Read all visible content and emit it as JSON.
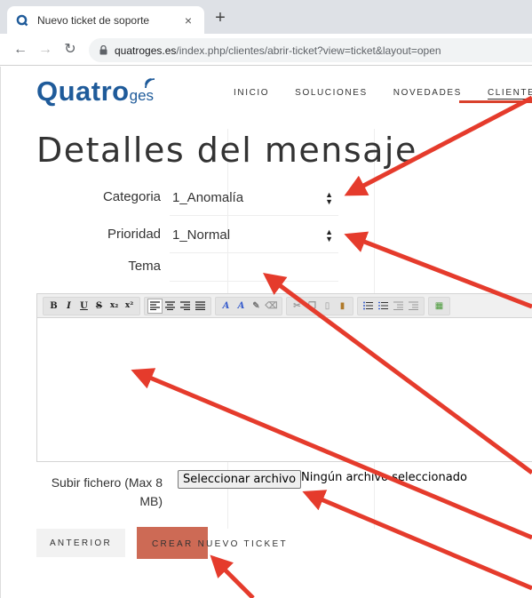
{
  "browser": {
    "tab_title": "Nuevo ticket de soporte",
    "tab_close": "×",
    "new_tab": "+",
    "url_host": "quatroges.es",
    "url_path": "/index.php/clientes/abrir-ticket?view=ticket&layout=open"
  },
  "site": {
    "logo_main": "Quatro",
    "logo_sub": "ges",
    "nav": [
      "INICIO",
      "SOLUCIONES",
      "NOVEDADES",
      "CLIENTES"
    ],
    "accent_color": "#1f5b9a"
  },
  "form": {
    "heading": "Detalles del mensaje",
    "categoria_label": "Categoria",
    "categoria_value": "1_Anomalía",
    "prioridad_label": "Prioridad",
    "prioridad_value": "1_Normal",
    "tema_label": "Tema",
    "tema_value": "",
    "upload_label": "Subir fichero (Max 8 MB)",
    "file_button": "Seleccionar archivo",
    "file_status": "Ningún archivo seleccionado",
    "btn_prev": "ANTERIOR",
    "btn_create": "CREAR NUEVO TICKET",
    "create_color": "#cd6a55"
  },
  "toolbar": {
    "bold": "B",
    "italic": "I",
    "underline": "U",
    "strike": "S",
    "subscript": "x₂",
    "superscript": "x²"
  },
  "annotation_color": "#e53b2c"
}
